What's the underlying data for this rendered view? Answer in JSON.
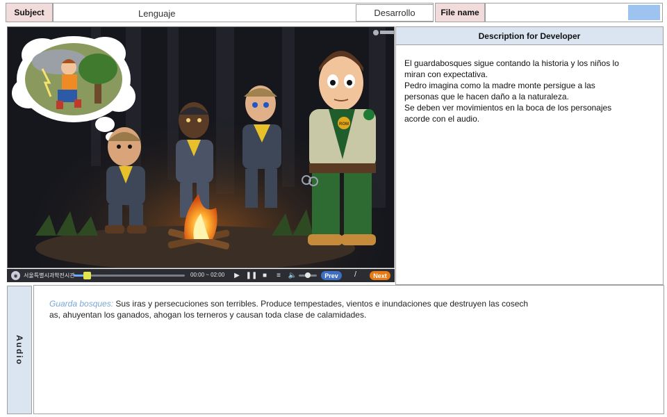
{
  "header": {
    "subject_label": "Subject",
    "subject_value": "Lenguaje",
    "section_value": "Desarrollo",
    "file_name_label": "File name",
    "file_name_value": "",
    "accent_color": "#9dc3f1"
  },
  "player": {
    "org_name": "서울특별시과학전시관",
    "time": "00:00 ~ 02:00",
    "prev_label": "Prev",
    "next_label": "Next",
    "slash": "/",
    "scene_badge": "ROM",
    "progress": 0.12,
    "volume": 0.5
  },
  "developer": {
    "title": "Description for Developer",
    "lines": [
      "El guardabosques  sigue contando la historia y los niños lo",
      "miran con expectativa.",
      "Pedro imagina como la madre  monte persigue  a las",
      "personas  que le hacen daño a  la naturaleza.",
      "Se deben ver movimientos  en la boca de los personajes",
      "acorde con el audio."
    ]
  },
  "audio": {
    "tab_label": "Audio",
    "speaker": "Guarda  bosques:",
    "line1": " Sus iras y persecuciones son terribles. Produce tempestades, vientos e inundaciones que destruyen las cosech",
    "line2": "as, ahuyentan  los ganados, ahogan los terneros y causan  toda clase de calamidades."
  }
}
